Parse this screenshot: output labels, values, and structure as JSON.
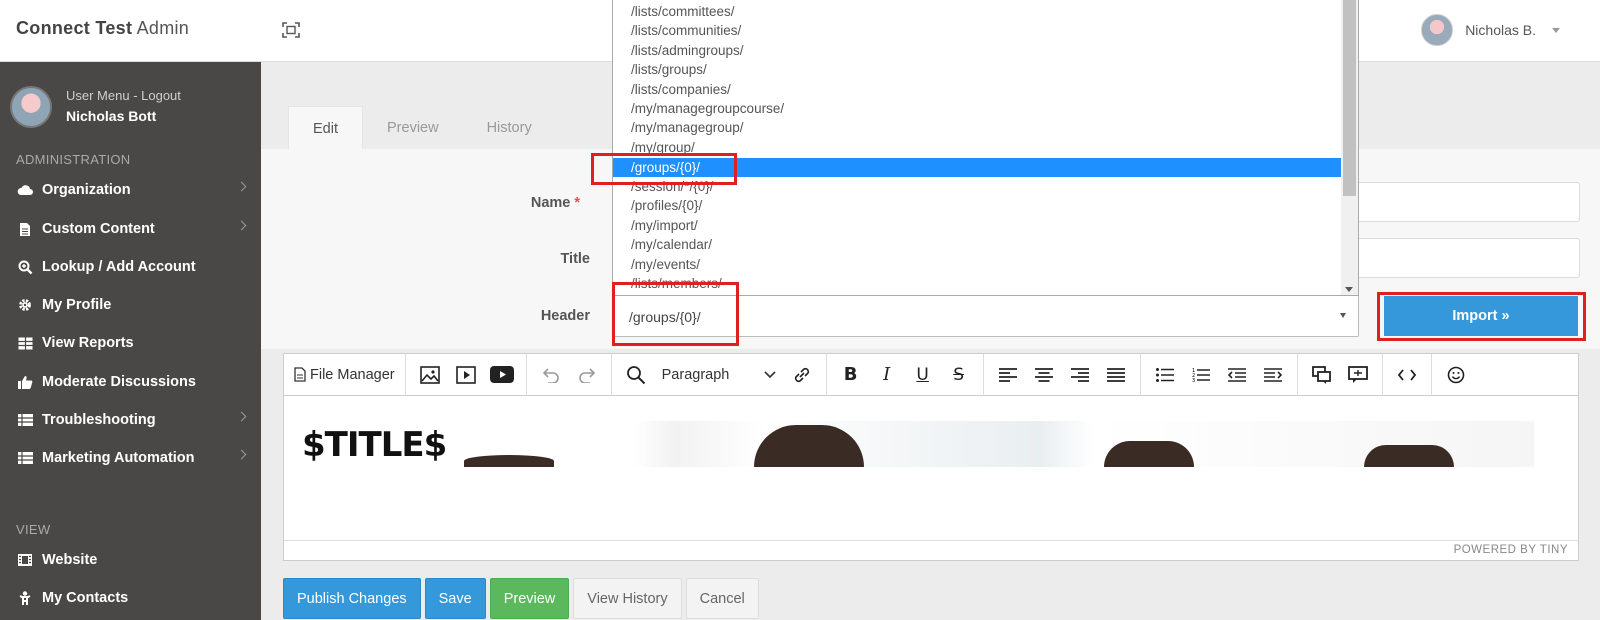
{
  "app": {
    "brand_bold": "Connect Test",
    "brand_rest": " Admin"
  },
  "top_user": {
    "name": "Nicholas B."
  },
  "sidebar": {
    "user_menu": "User Menu - Logout",
    "user_name": "Nicholas Bott",
    "section_admin": "ADMINISTRATION",
    "section_view": "VIEW",
    "items": [
      {
        "label": "Organization",
        "icon": "cloud-icon",
        "chevron": true
      },
      {
        "label": "Custom Content",
        "icon": "file-icon",
        "chevron": true
      },
      {
        "label": "Lookup / Add Account",
        "icon": "search-plus-icon",
        "chevron": false
      },
      {
        "label": "My Profile",
        "icon": "gear-icon",
        "chevron": false
      },
      {
        "label": "View Reports",
        "icon": "table-icon",
        "chevron": false
      },
      {
        "label": "Moderate Discussions",
        "icon": "thumbs-up-icon",
        "chevron": false
      },
      {
        "label": "Troubleshooting",
        "icon": "list-icon",
        "chevron": true
      },
      {
        "label": "Marketing Automation",
        "icon": "list-icon",
        "chevron": true
      }
    ],
    "view_items": [
      {
        "label": "Website",
        "icon": "film-icon"
      },
      {
        "label": "My Contacts",
        "icon": "person-icon"
      }
    ]
  },
  "tabs": [
    {
      "label": "Edit",
      "active": true
    },
    {
      "label": "Preview",
      "active": false
    },
    {
      "label": "History",
      "active": false
    }
  ],
  "form": {
    "name_label": "Name",
    "required_mark": "*",
    "title_label": "Title",
    "header_label": "Header",
    "header_value": "/groups/{0}/",
    "import_label": "Import »"
  },
  "dropdown": {
    "options": [
      "/lists/committees/",
      "/lists/communities/",
      "/lists/admingroups/",
      "/lists/groups/",
      "/lists/companies/",
      "/my/managegroupcourse/",
      "/my/managegroup/",
      "/my/group/",
      "/groups/{0}/",
      "/session/*/{0}/",
      "/profiles/{0}/",
      "/my/import/",
      "/my/calendar/",
      "/my/events/",
      "/lists/members/"
    ],
    "selected_index": 8
  },
  "editor": {
    "file_manager": "File Manager",
    "block_format": "Paragraph",
    "content_title": "$TITLE$",
    "powered_by": "POWERED BY TINY"
  },
  "actions": {
    "publish": "Publish Changes",
    "save": "Save",
    "preview": "Preview",
    "history": "View History",
    "cancel": "Cancel"
  },
  "colors": {
    "primary": "#3498db",
    "success": "#5cb85c",
    "sidebar": "#4a4846",
    "highlight": "#e02020"
  }
}
